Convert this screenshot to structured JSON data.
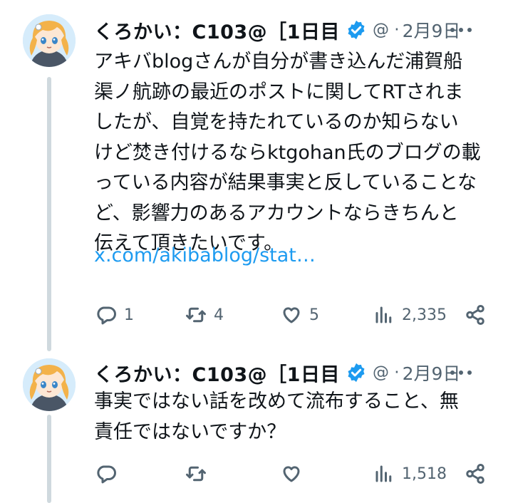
{
  "tweets": [
    {
      "name": "くろかい：C103@［1日目",
      "handle": "@ ·",
      "date": "2月9日",
      "lines": [
        "アキバblogさんが自分が書き込んだ浦賀船",
        "渠ノ航跡の最近のポストに関してRTされま",
        "したが、自覚を持たれているのか知らない",
        "けど焚き付けるならktgohan氏のブログの載",
        "っている内容が結果事実と反していることな",
        "ど、影響力のあるアカウントならきちんと",
        "伝えて頂きたいです。"
      ],
      "link": "x.com/akibablog/stat…",
      "replies": "1",
      "retweets": "4",
      "likes": "5",
      "views": "2,335"
    },
    {
      "name": "くろかい：C103@［1日目",
      "handle": "@ ·",
      "date": "2月9日",
      "lines": [
        "事実ではない話を改めて流布すること、無",
        "責任ではないですか？"
      ],
      "views": "1,518"
    }
  ],
  "colors": {
    "accent": "#1d9bf0",
    "muted": "#536471",
    "text": "#0f1419",
    "thread_line": "#cfd9de"
  },
  "icons": [
    "avatar",
    "verified-badge-icon",
    "more-icon",
    "reply-icon",
    "retweet-icon",
    "like-icon",
    "views-icon",
    "share-icon"
  ]
}
